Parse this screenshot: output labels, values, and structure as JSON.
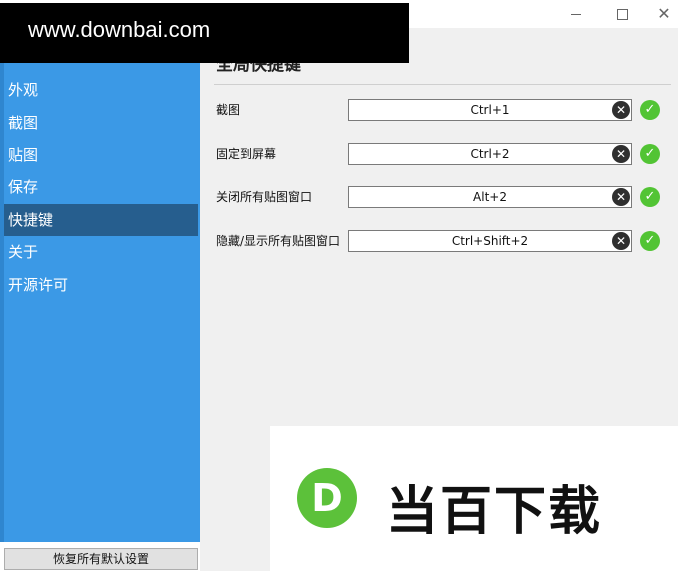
{
  "window": {
    "minimize_glyph": "",
    "close_glyph": "✕"
  },
  "sidebar": {
    "items": [
      {
        "label": "外观"
      },
      {
        "label": "截图"
      },
      {
        "label": "贴图"
      },
      {
        "label": "保存"
      },
      {
        "label": "快捷键",
        "active": true
      },
      {
        "label": "关于"
      },
      {
        "label": "开源许可"
      }
    ],
    "reset_label": "恢复所有默认设置"
  },
  "main": {
    "section_title": "全局快捷键",
    "hotkeys": [
      {
        "label": "截图",
        "value": "Ctrl+1"
      },
      {
        "label": "固定到屏幕",
        "value": "Ctrl+2"
      },
      {
        "label": "关闭所有贴图窗口",
        "value": "Alt+2"
      },
      {
        "label": "隐藏/显示所有贴图窗口",
        "value": "Ctrl+Shift+2"
      }
    ],
    "clear_glyph": "✕",
    "ok_glyph": "✓"
  },
  "watermark": {
    "site": "www.downbai.com",
    "brand_text": "当百下载",
    "logo_letter": "D"
  },
  "colors": {
    "sidebar": "#3b99e6",
    "sidebar_active": "#265e8e",
    "ok_green": "#52c434"
  }
}
